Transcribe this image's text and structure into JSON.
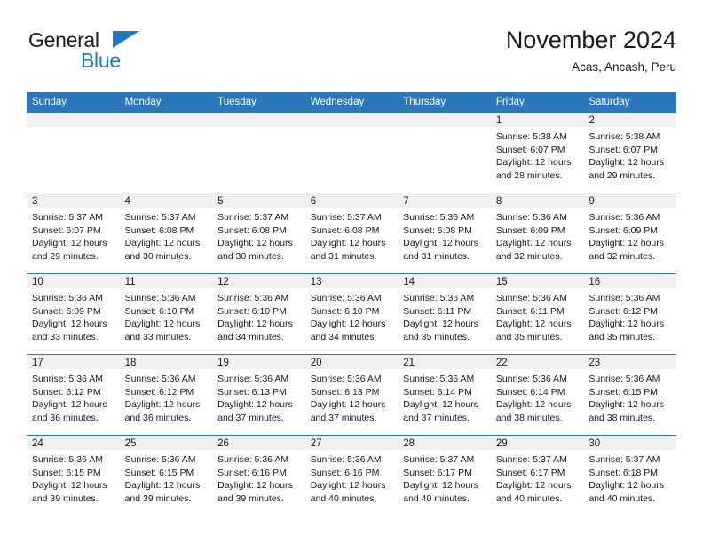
{
  "brand": {
    "name_part1": "General",
    "name_part2": "Blue",
    "triangle_color": "#1f7ac4",
    "accent_color": "#2a77bb"
  },
  "header": {
    "title": "November 2024",
    "subtitle": "Acas, Ancash, Peru"
  },
  "weekday_headers": [
    "Sunday",
    "Monday",
    "Tuesday",
    "Wednesday",
    "Thursday",
    "Friday",
    "Saturday"
  ],
  "weeks": [
    [
      {
        "day": "",
        "empty": true,
        "sunrise": "",
        "sunset": "",
        "daylight_line1": "",
        "daylight_line2": ""
      },
      {
        "day": "",
        "empty": true,
        "sunrise": "",
        "sunset": "",
        "daylight_line1": "",
        "daylight_line2": ""
      },
      {
        "day": "",
        "empty": true,
        "sunrise": "",
        "sunset": "",
        "daylight_line1": "",
        "daylight_line2": ""
      },
      {
        "day": "",
        "empty": true,
        "sunrise": "",
        "sunset": "",
        "daylight_line1": "",
        "daylight_line2": ""
      },
      {
        "day": "",
        "empty": true,
        "sunrise": "",
        "sunset": "",
        "daylight_line1": "",
        "daylight_line2": ""
      },
      {
        "day": "1",
        "empty": false,
        "sunrise": "Sunrise: 5:38 AM",
        "sunset": "Sunset: 6:07 PM",
        "daylight_line1": "Daylight: 12 hours",
        "daylight_line2": "and 28 minutes."
      },
      {
        "day": "2",
        "empty": false,
        "sunrise": "Sunrise: 5:38 AM",
        "sunset": "Sunset: 6:07 PM",
        "daylight_line1": "Daylight: 12 hours",
        "daylight_line2": "and 29 minutes."
      }
    ],
    [
      {
        "day": "3",
        "empty": false,
        "sunrise": "Sunrise: 5:37 AM",
        "sunset": "Sunset: 6:07 PM",
        "daylight_line1": "Daylight: 12 hours",
        "daylight_line2": "and 29 minutes."
      },
      {
        "day": "4",
        "empty": false,
        "sunrise": "Sunrise: 5:37 AM",
        "sunset": "Sunset: 6:08 PM",
        "daylight_line1": "Daylight: 12 hours",
        "daylight_line2": "and 30 minutes."
      },
      {
        "day": "5",
        "empty": false,
        "sunrise": "Sunrise: 5:37 AM",
        "sunset": "Sunset: 6:08 PM",
        "daylight_line1": "Daylight: 12 hours",
        "daylight_line2": "and 30 minutes."
      },
      {
        "day": "6",
        "empty": false,
        "sunrise": "Sunrise: 5:37 AM",
        "sunset": "Sunset: 6:08 PM",
        "daylight_line1": "Daylight: 12 hours",
        "daylight_line2": "and 31 minutes."
      },
      {
        "day": "7",
        "empty": false,
        "sunrise": "Sunrise: 5:36 AM",
        "sunset": "Sunset: 6:08 PM",
        "daylight_line1": "Daylight: 12 hours",
        "daylight_line2": "and 31 minutes."
      },
      {
        "day": "8",
        "empty": false,
        "sunrise": "Sunrise: 5:36 AM",
        "sunset": "Sunset: 6:09 PM",
        "daylight_line1": "Daylight: 12 hours",
        "daylight_line2": "and 32 minutes."
      },
      {
        "day": "9",
        "empty": false,
        "sunrise": "Sunrise: 5:36 AM",
        "sunset": "Sunset: 6:09 PM",
        "daylight_line1": "Daylight: 12 hours",
        "daylight_line2": "and 32 minutes."
      }
    ],
    [
      {
        "day": "10",
        "empty": false,
        "sunrise": "Sunrise: 5:36 AM",
        "sunset": "Sunset: 6:09 PM",
        "daylight_line1": "Daylight: 12 hours",
        "daylight_line2": "and 33 minutes."
      },
      {
        "day": "11",
        "empty": false,
        "sunrise": "Sunrise: 5:36 AM",
        "sunset": "Sunset: 6:10 PM",
        "daylight_line1": "Daylight: 12 hours",
        "daylight_line2": "and 33 minutes."
      },
      {
        "day": "12",
        "empty": false,
        "sunrise": "Sunrise: 5:36 AM",
        "sunset": "Sunset: 6:10 PM",
        "daylight_line1": "Daylight: 12 hours",
        "daylight_line2": "and 34 minutes."
      },
      {
        "day": "13",
        "empty": false,
        "sunrise": "Sunrise: 5:36 AM",
        "sunset": "Sunset: 6:10 PM",
        "daylight_line1": "Daylight: 12 hours",
        "daylight_line2": "and 34 minutes."
      },
      {
        "day": "14",
        "empty": false,
        "sunrise": "Sunrise: 5:36 AM",
        "sunset": "Sunset: 6:11 PM",
        "daylight_line1": "Daylight: 12 hours",
        "daylight_line2": "and 35 minutes."
      },
      {
        "day": "15",
        "empty": false,
        "sunrise": "Sunrise: 5:36 AM",
        "sunset": "Sunset: 6:11 PM",
        "daylight_line1": "Daylight: 12 hours",
        "daylight_line2": "and 35 minutes."
      },
      {
        "day": "16",
        "empty": false,
        "sunrise": "Sunrise: 5:36 AM",
        "sunset": "Sunset: 6:12 PM",
        "daylight_line1": "Daylight: 12 hours",
        "daylight_line2": "and 35 minutes."
      }
    ],
    [
      {
        "day": "17",
        "empty": false,
        "sunrise": "Sunrise: 5:36 AM",
        "sunset": "Sunset: 6:12 PM",
        "daylight_line1": "Daylight: 12 hours",
        "daylight_line2": "and 36 minutes."
      },
      {
        "day": "18",
        "empty": false,
        "sunrise": "Sunrise: 5:36 AM",
        "sunset": "Sunset: 6:12 PM",
        "daylight_line1": "Daylight: 12 hours",
        "daylight_line2": "and 36 minutes."
      },
      {
        "day": "19",
        "empty": false,
        "sunrise": "Sunrise: 5:36 AM",
        "sunset": "Sunset: 6:13 PM",
        "daylight_line1": "Daylight: 12 hours",
        "daylight_line2": "and 37 minutes."
      },
      {
        "day": "20",
        "empty": false,
        "sunrise": "Sunrise: 5:36 AM",
        "sunset": "Sunset: 6:13 PM",
        "daylight_line1": "Daylight: 12 hours",
        "daylight_line2": "and 37 minutes."
      },
      {
        "day": "21",
        "empty": false,
        "sunrise": "Sunrise: 5:36 AM",
        "sunset": "Sunset: 6:14 PM",
        "daylight_line1": "Daylight: 12 hours",
        "daylight_line2": "and 37 minutes."
      },
      {
        "day": "22",
        "empty": false,
        "sunrise": "Sunrise: 5:36 AM",
        "sunset": "Sunset: 6:14 PM",
        "daylight_line1": "Daylight: 12 hours",
        "daylight_line2": "and 38 minutes."
      },
      {
        "day": "23",
        "empty": false,
        "sunrise": "Sunrise: 5:36 AM",
        "sunset": "Sunset: 6:15 PM",
        "daylight_line1": "Daylight: 12 hours",
        "daylight_line2": "and 38 minutes."
      }
    ],
    [
      {
        "day": "24",
        "empty": false,
        "sunrise": "Sunrise: 5:36 AM",
        "sunset": "Sunset: 6:15 PM",
        "daylight_line1": "Daylight: 12 hours",
        "daylight_line2": "and 39 minutes."
      },
      {
        "day": "25",
        "empty": false,
        "sunrise": "Sunrise: 5:36 AM",
        "sunset": "Sunset: 6:15 PM",
        "daylight_line1": "Daylight: 12 hours",
        "daylight_line2": "and 39 minutes."
      },
      {
        "day": "26",
        "empty": false,
        "sunrise": "Sunrise: 5:36 AM",
        "sunset": "Sunset: 6:16 PM",
        "daylight_line1": "Daylight: 12 hours",
        "daylight_line2": "and 39 minutes."
      },
      {
        "day": "27",
        "empty": false,
        "sunrise": "Sunrise: 5:36 AM",
        "sunset": "Sunset: 6:16 PM",
        "daylight_line1": "Daylight: 12 hours",
        "daylight_line2": "and 40 minutes."
      },
      {
        "day": "28",
        "empty": false,
        "sunrise": "Sunrise: 5:37 AM",
        "sunset": "Sunset: 6:17 PM",
        "daylight_line1": "Daylight: 12 hours",
        "daylight_line2": "and 40 minutes."
      },
      {
        "day": "29",
        "empty": false,
        "sunrise": "Sunrise: 5:37 AM",
        "sunset": "Sunset: 6:17 PM",
        "daylight_line1": "Daylight: 12 hours",
        "daylight_line2": "and 40 minutes."
      },
      {
        "day": "30",
        "empty": false,
        "sunrise": "Sunrise: 5:37 AM",
        "sunset": "Sunset: 6:18 PM",
        "daylight_line1": "Daylight: 12 hours",
        "daylight_line2": "and 40 minutes."
      }
    ]
  ]
}
